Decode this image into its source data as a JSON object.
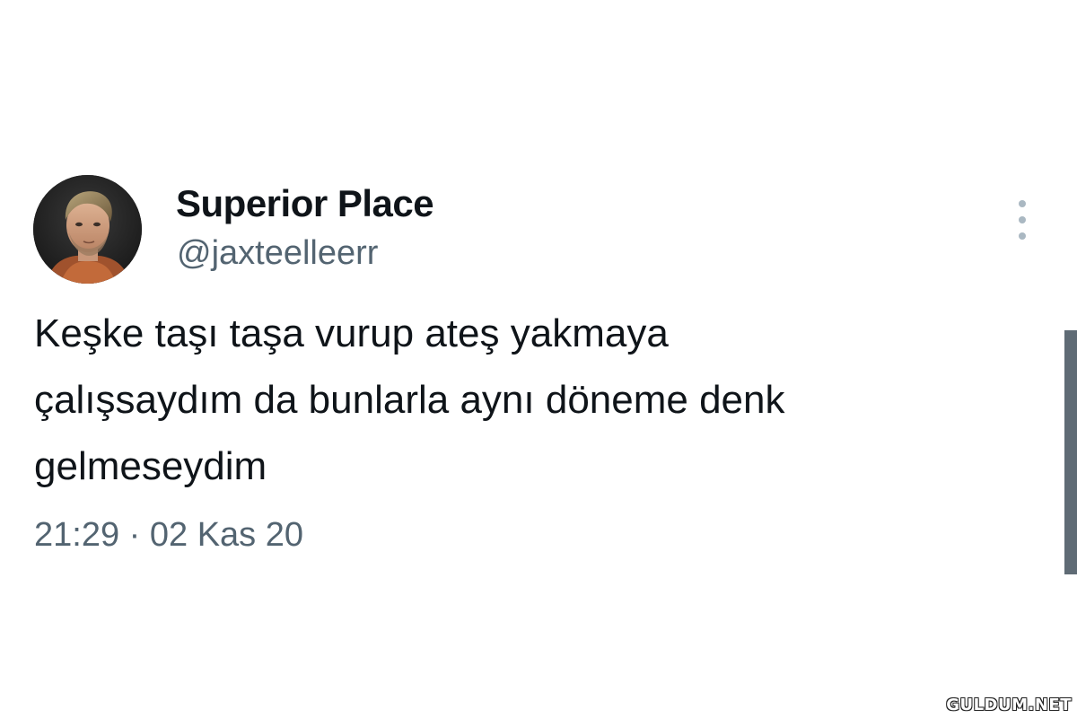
{
  "tweet": {
    "display_name": "Superior Place",
    "handle": "@jaxteelleerr",
    "text": "Keşke taşı taşa vurup ateş yakmaya\nçalışsaydım da bunlarla aynı döneme denk\ngelmeseydim",
    "timestamp": "21:29 · 02 Kas 20",
    "avatar_icon": "profile-photo-avatar",
    "more_icon": "vertical-ellipsis-icon"
  },
  "watermark": {
    "text": "GULDUM.NET"
  },
  "colors": {
    "primary_text": "#0f1419",
    "secondary_text": "#536471",
    "background": "#ffffff",
    "more_dots": "#aab8c2",
    "scrollbar": "#5f6b75"
  }
}
